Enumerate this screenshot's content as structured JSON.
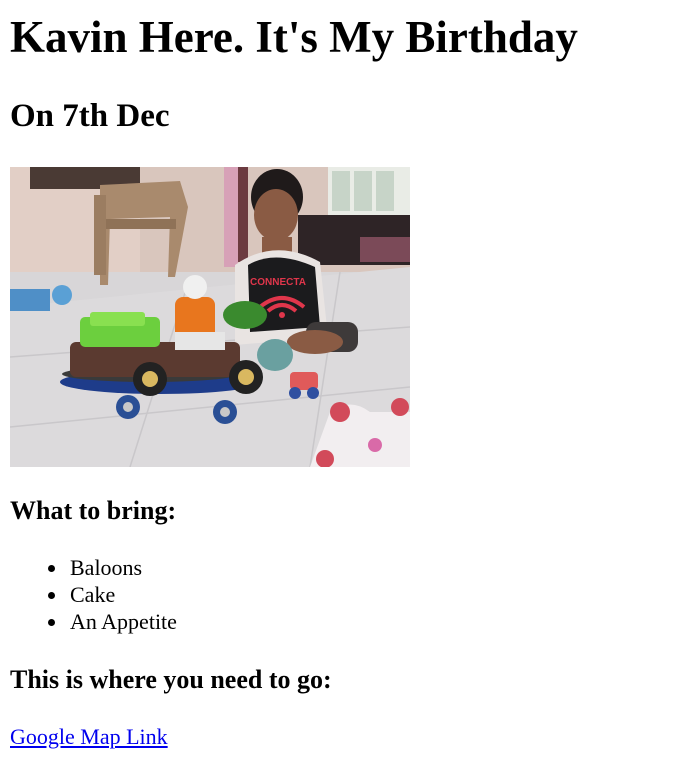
{
  "header": {
    "title": "Kavin Here. It's My Birthday",
    "date_heading": "On 7th Dec"
  },
  "photo": {
    "subject": "child-with-toys-on-skateboard",
    "shirt_text": "CONNECTA"
  },
  "bring": {
    "heading": "What to bring:",
    "items": [
      "Baloons",
      "Cake",
      "An Appetite"
    ]
  },
  "location": {
    "heading": "This is where you need to go:",
    "link_label": "Google Map Link"
  },
  "colors": {
    "link": "#0000ee",
    "text": "#000000",
    "background": "#ffffff"
  }
}
